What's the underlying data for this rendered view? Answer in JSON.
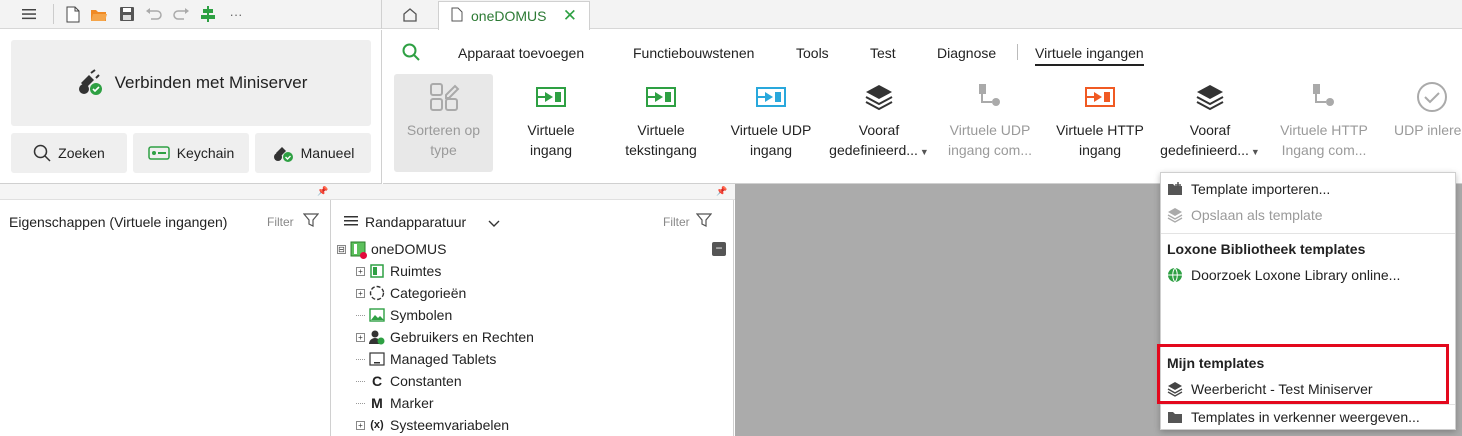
{
  "toolbar": {
    "icons": [
      "menu-icon",
      "new-file-icon",
      "open-folder-icon",
      "save-icon",
      "undo-icon",
      "redo-icon",
      "align-icon",
      "more-icon"
    ],
    "more_label": "···"
  },
  "tabs": {
    "home_icon": "home-icon",
    "document_title": "oneDOMUS",
    "close_glyph": "✕"
  },
  "connect": {
    "main_label": "Verbinden met Miniserver",
    "search_label": "Zoeken",
    "keychain_label": "Keychain",
    "manual_label": "Manueel"
  },
  "ribbon": {
    "tabs": [
      "Apparaat toevoegen",
      "Functiebouwstenen",
      "Tools",
      "Test",
      "Diagnose",
      "Virtuele ingangen"
    ],
    "active_tab": "Virtuele ingangen",
    "buttons": [
      {
        "line1": "Sorteren op",
        "line2": "type"
      },
      {
        "line1": "Virtuele",
        "line2": "ingang"
      },
      {
        "line1": "Virtuele",
        "line2": "tekstingang"
      },
      {
        "line1": "Virtuele UDP",
        "line2": "ingang"
      },
      {
        "line1": "Vooraf",
        "line2": "gedefinieerd..."
      },
      {
        "line1": "Virtuele UDP",
        "line2": "ingang com..."
      },
      {
        "line1": "Virtuele HTTP",
        "line2": "ingang"
      },
      {
        "line1": "Vooraf",
        "line2": "gedefinieerd..."
      },
      {
        "line1": "Virtuele HTTP",
        "line2": "Ingang com..."
      },
      {
        "line1": "UDP inlere",
        "line2": ""
      }
    ]
  },
  "properties_panel": {
    "title": "Eigenschappen (Virtuele ingangen)",
    "filter_label": "Filter"
  },
  "periphery_panel": {
    "title": "Randapparatuur",
    "filter_label": "Filter",
    "collapse_glyph": "−",
    "tree": [
      {
        "label": "oneDOMUS",
        "expand": "⊟"
      },
      {
        "label": "Ruimtes",
        "expand": "+"
      },
      {
        "label": "Categorieën",
        "expand": "+"
      },
      {
        "label": "Symbolen",
        "expand": ""
      },
      {
        "label": "Gebruikers en Rechten",
        "expand": "+"
      },
      {
        "label": "Managed Tablets",
        "expand": ""
      },
      {
        "label": "Constanten",
        "expand": ""
      },
      {
        "label": "Marker",
        "expand": ""
      },
      {
        "label": "Systeemvariabelen",
        "expand": "+"
      }
    ]
  },
  "dropdown": {
    "import_label": "Template importeren...",
    "save_label": "Opslaan als template",
    "library_header": "Loxone Bibliotheek templates",
    "library_search_label": "Doorzoek Loxone Library online...",
    "my_templates_header": "Mijn templates",
    "my_template_item": "Weerbericht - Test Miniserver",
    "show_in_explorer_label": "Templates in verkenner weergeven..."
  },
  "colors": {
    "accent_green": "#2ea043",
    "highlight_red": "#e3081d",
    "canvas_gray": "#ababab"
  }
}
